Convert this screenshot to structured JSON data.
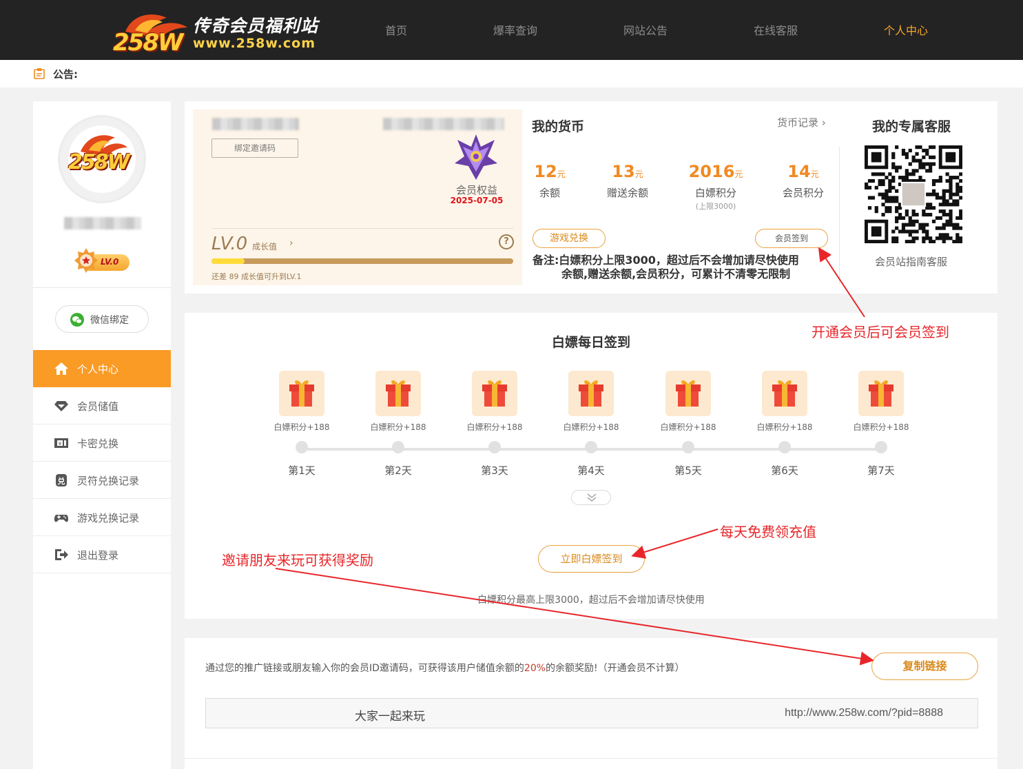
{
  "header": {
    "logo_badge": "258W",
    "site_name": "传奇会员福利站",
    "site_url": "www.258w.com",
    "nav": [
      {
        "label": "首页",
        "active": false
      },
      {
        "label": "爆率查询",
        "active": false
      },
      {
        "label": "网站公告",
        "active": false
      },
      {
        "label": "在线客服",
        "active": false
      },
      {
        "label": "个人中心",
        "active": true
      }
    ]
  },
  "notice": {
    "label": "公告:"
  },
  "sidebar": {
    "avatar_text": "258W",
    "level": "LV.0",
    "wechat_bind": "微信绑定",
    "menu": [
      {
        "label": "个人中心",
        "icon": "home-icon",
        "active": true
      },
      {
        "label": "会员储值",
        "icon": "diamond-icon",
        "active": false
      },
      {
        "label": "卡密兑换",
        "icon": "card-icon",
        "active": false
      },
      {
        "label": "灵符兑换记录",
        "icon": "exchange-icon",
        "active": false
      },
      {
        "label": "游戏兑换记录",
        "icon": "gamepad-icon",
        "active": false
      },
      {
        "label": "退出登录",
        "icon": "logout-icon",
        "active": false
      }
    ]
  },
  "member": {
    "bind_invite": "绑定邀请码",
    "rights_label": "会员权益",
    "rights_date": "2025-07-05",
    "level": "LV.0",
    "growth_label": "成长值",
    "growth_progress": 0.11,
    "upgrade_hint": "还差 89 成长值可升到LV.1"
  },
  "currency": {
    "title": "我的货币",
    "record_link": "货币记录",
    "unit": "元",
    "items": [
      {
        "value": "12",
        "label": "余额",
        "sub": ""
      },
      {
        "value": "13",
        "label": "赠送余额",
        "sub": ""
      },
      {
        "value": "2016",
        "label": "白嫖积分",
        "sub": "(上限3000)"
      },
      {
        "value": "14",
        "label": "会员积分",
        "sub": ""
      }
    ],
    "game_exchange": "游戏兑换",
    "member_sign": "会员签到",
    "remark_line1": "备注:白嫖积分上限3000，超过后不会增加请尽快使用",
    "remark_line2": "余额,赠送余额,会员积分，可累计不清零无限制"
  },
  "service": {
    "title": "我的专属客服",
    "label": "会员站指南客服"
  },
  "signin": {
    "title": "白嫖每日签到",
    "days": [
      {
        "reward": "白嫖积分+188",
        "label": "第1天"
      },
      {
        "reward": "白嫖积分+188",
        "label": "第2天"
      },
      {
        "reward": "白嫖积分+188",
        "label": "第3天"
      },
      {
        "reward": "白嫖积分+188",
        "label": "第4天"
      },
      {
        "reward": "白嫖积分+188",
        "label": "第5天"
      },
      {
        "reward": "白嫖积分+188",
        "label": "第6天"
      },
      {
        "reward": "白嫖积分+188",
        "label": "第7天"
      }
    ],
    "sign_button": "立即白嫖签到",
    "note": "白嫖积分最高上限3000，超过后不会增加请尽快使用"
  },
  "invite": {
    "text_before": "通过您的推广链接或朋友输入你的会员ID邀请码，可获得该用户储值余额的",
    "percent": "20%",
    "text_after": "的余额奖励!（开通会员不计算）",
    "copy_button": "复制链接",
    "link_text": "大家一起来玩",
    "link_url": "http://www.258w.com/?pid=8888"
  },
  "annotations": {
    "member_sign": "开通会员后可会员签到",
    "daily_free": "每天免费领充值",
    "invite_friends": "邀请朋友来玩可获得奖励"
  },
  "colors": {
    "accent": "#fa9b26",
    "topbar": "#232323",
    "annotation": "#e8262a",
    "coin_value": "#f08a22"
  }
}
